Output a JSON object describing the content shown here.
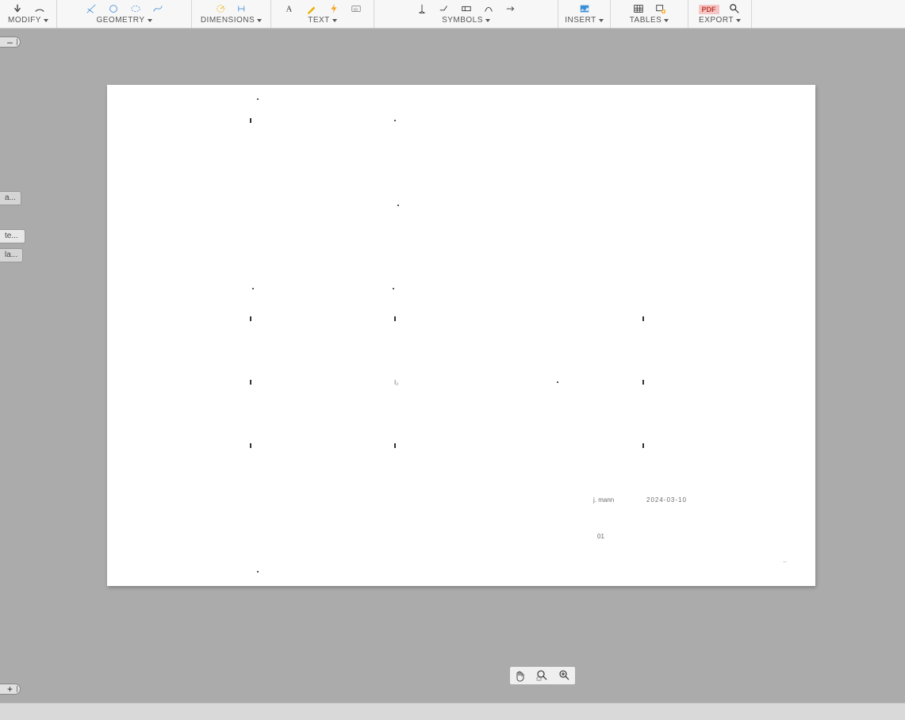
{
  "ribbon": {
    "groups": [
      {
        "key": "modify",
        "label": "MODIFY"
      },
      {
        "key": "geometry",
        "label": "GEOMETRY"
      },
      {
        "key": "dimensions",
        "label": "DIMENSIONS"
      },
      {
        "key": "text",
        "label": "TEXT"
      },
      {
        "key": "symbols",
        "label": "SYMBOLS"
      },
      {
        "key": "insert",
        "label": "INSERT"
      },
      {
        "key": "tables",
        "label": "TABLES"
      },
      {
        "key": "export",
        "label": "EXPORT",
        "badge": "PDF"
      }
    ]
  },
  "left_toggles": {
    "top": "–",
    "bottom": "+"
  },
  "side_tabs": [
    {
      "label": "a..."
    },
    {
      "label": "te..."
    },
    {
      "label": "la..."
    }
  ],
  "page_annotations": {
    "date_stamp": "2024-03-10",
    "author": "j. mann",
    "revision": "01"
  }
}
